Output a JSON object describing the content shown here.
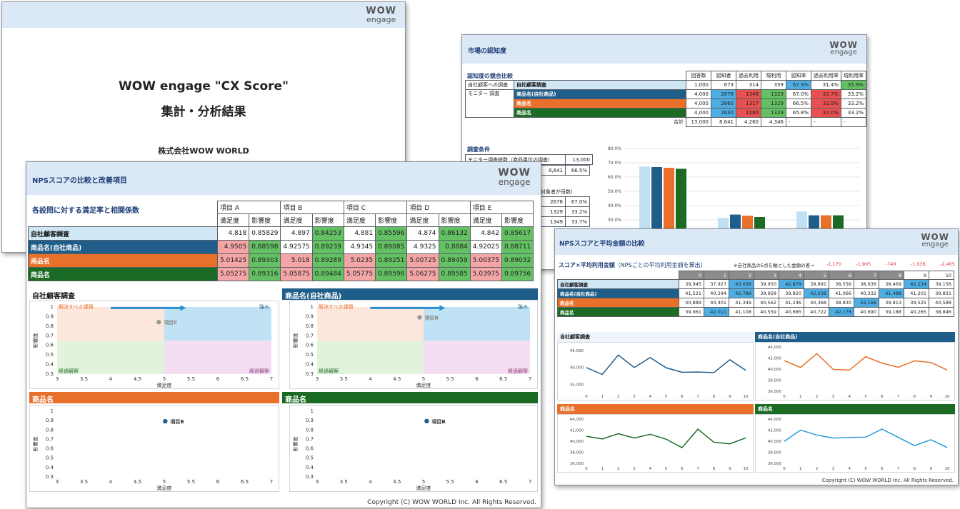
{
  "title_slide": {
    "logo_top": "WOW",
    "logo_bottom": "engage",
    "title_line1": "WOW engage \"CX Score\"",
    "title_line2": "集計・分析結果",
    "company": "株式会社WOW WORLD"
  },
  "recognition_slide": {
    "header": "市場の認知度",
    "logo_top": "WOW",
    "logo_bottom": "engage",
    "section1": "認知度の競合比較",
    "columns": [
      "回答数",
      "認知者",
      "過去利用",
      "現利用",
      "認知率",
      "過去利用率",
      "現利用率"
    ],
    "own_survey_label": "自社顧客への調査",
    "monitor_label": "モニター 調査",
    "rows": [
      {
        "name": "自社顧客調査",
        "values": [
          "1,000",
          "673",
          "314",
          "359",
          "67.3%",
          "31.4%",
          "35.9%"
        ]
      },
      {
        "name": "商品名(自社商品)",
        "values": [
          "4,000",
          "2678",
          "1349",
          "1329",
          "67.0%",
          "33.7%",
          "33.2%"
        ]
      },
      {
        "name": "商品名",
        "values": [
          "4,000",
          "2660",
          "1317",
          "1329",
          "66.5%",
          "32.9%",
          "33.2%"
        ]
      },
      {
        "name": "商品名",
        "values": [
          "4,000",
          "2630",
          "1280",
          "1329",
          "65.8%",
          "32.0%",
          "33.2%"
        ]
      }
    ],
    "total_label": "合計",
    "total_values": [
      "13,000",
      "8,641",
      "4,260",
      "4,346",
      "-",
      "-",
      "-"
    ],
    "section2": "調査条件",
    "cond_label": "モニター調査総数（商品単位の調査）",
    "cond_value": "13,000",
    "cond_row2": [
      "8,641",
      "66.5%"
    ],
    "sub_note": "対象者が母数)",
    "side_rows": [
      [
        "2678",
        "67.0%"
      ],
      [
        "1329",
        "33.2%"
      ],
      [
        "1349",
        "33.7%"
      ]
    ],
    "y_ticks": [
      "80.0%",
      "70.0%",
      "60.0%",
      "50.0%",
      "40.0%",
      "30.0%",
      "20.0%",
      "10.0%"
    ]
  },
  "nps_slide": {
    "header": "NPSスコアの比較と改善項目",
    "logo_top": "WOW",
    "logo_bottom": "engage",
    "subtitle": "各設問に対する満足率と相関係数",
    "items": [
      "項目 A",
      "項目 B",
      "項目 C",
      "項目 D",
      "項目 E"
    ],
    "sub_cols": [
      "満足度",
      "影響度"
    ],
    "rows": [
      {
        "name": "自社顧客調査",
        "values": [
          "4.818",
          "0.85829",
          "4.897",
          "0.84253",
          "4.881",
          "0.85596",
          "4.874",
          "0.86132",
          "4.842",
          "0.85617"
        ]
      },
      {
        "name": "商品名(自社商品)",
        "values": [
          "4.9505",
          "0.88598",
          "4.92575",
          "0.89239",
          "4.9345",
          "0.89085",
          "4.9325",
          "0.8884",
          "4.92025",
          "0.88711"
        ]
      },
      {
        "name": "商品名",
        "values": [
          "5.01425",
          "0.89303",
          "5.018",
          "0.89289",
          "5.0235",
          "0.89251",
          "5.00725",
          "0.89459",
          "5.00375",
          "0.89032"
        ]
      },
      {
        "name": "商品名",
        "values": [
          "5.05275",
          "0.89316",
          "5.05875",
          "0.89484",
          "5.05775",
          "0.89596",
          "5.06275",
          "0.89585",
          "5.03975",
          "0.89756"
        ]
      }
    ],
    "panels": [
      {
        "title": "自社顧客調査",
        "point": "項目C"
      },
      {
        "title": "商品名(自社商品)",
        "point": "項目B"
      },
      {
        "title": "商品名",
        "point": "項目B"
      },
      {
        "title": "商品名",
        "point": "項目B"
      }
    ],
    "quad_issue": "解決すべき課題",
    "quad_strength": "強み",
    "quad_watch": "経過観察",
    "x_label": "満足度",
    "y_label": "影響度",
    "x_ticks": [
      "3",
      "3.5",
      "4",
      "4.5",
      "5",
      "5.5",
      "6",
      "6.5",
      "7"
    ],
    "y_ticks": [
      "1",
      "0.9",
      "0.8",
      "0.7",
      "0.6",
      "0.5",
      "0.4",
      "0.3"
    ],
    "copyright": "Copyright (C) WOW WORLD Inc. All Rights Reserved."
  },
  "amount_slide": {
    "header": "NPSスコアと平均金額の比較",
    "logo_top": "WOW",
    "logo_bottom": "engage",
    "subtitle": "スコア×平均利用金額",
    "subtitle_note": "（NPSごとの平均利用金額を算出）",
    "diff_note": "※自社商品の5点を軸とした金額の差→",
    "diffs": [
      "-1,170",
      "-1,905",
      "-749",
      "-1,036",
      "-2,405"
    ],
    "scores": [
      "0",
      "1",
      "2",
      "3",
      "4",
      "5",
      "6",
      "7",
      "8",
      "9",
      "10"
    ],
    "rows": [
      {
        "name": "自社顧客調査",
        "values": [
          "39,945",
          "37,927",
          "43,636",
          "39,950",
          "42,879",
          "39,891",
          "38,556",
          "38,636",
          "38,469",
          "42,234",
          "39,156"
        ]
      },
      {
        "name": "商品名(自社商品)",
        "values": [
          "41,521",
          "40,294",
          "42,789",
          "39,958",
          "39,820",
          "42,236",
          "41,066",
          "40,332",
          "41,488",
          "41,201",
          "39,831"
        ]
      },
      {
        "name": "商品名",
        "values": [
          "40,889",
          "40,401",
          "41,349",
          "40,562",
          "41,246",
          "40,368",
          "38,830",
          "42,166",
          "39,813",
          "39,525",
          "40,588"
        ]
      },
      {
        "name": "商品名",
        "values": [
          "39,961",
          "42,011",
          "41,108",
          "40,559",
          "40,685",
          "40,722",
          "42,176",
          "40,690",
          "39,188",
          "40,265",
          "38,846"
        ]
      }
    ],
    "charts": [
      {
        "title": "自社顧客調査",
        "yticks": [
          "45,000",
          "40,000",
          "35,000"
        ]
      },
      {
        "title": "商品名(自社商品)",
        "yticks": [
          "44,000",
          "42,000",
          "40,000",
          "38,000",
          "36,000"
        ]
      },
      {
        "title": "商品名",
        "yticks": [
          "44,000",
          "42,000",
          "40,000",
          "38,000",
          "36,000"
        ]
      },
      {
        "title": "商品名",
        "yticks": [
          "44,000",
          "42,000",
          "40,000",
          "38,000",
          "36,000"
        ]
      }
    ],
    "copyright": "Copyright (C) WOW WORLD Inc. All Rights Reserved."
  },
  "colors": {
    "own": "#cfe6f5",
    "brand1": "#1f5d8a",
    "brand2": "#e8702a",
    "brand3": "#1c6b25",
    "header": "#dbe8f6"
  },
  "chart_data": [
    {
      "type": "bar",
      "categories": [
        "認知率",
        "過去利用率",
        "現利用率"
      ],
      "series": [
        {
          "name": "自社顧客調査",
          "values": [
            67.3,
            31.4,
            35.9
          ]
        },
        {
          "name": "商品名(自社商品)",
          "values": [
            67.0,
            33.7,
            33.2
          ]
        },
        {
          "name": "商品名",
          "values": [
            66.5,
            32.9,
            33.2
          ]
        },
        {
          "name": "商品名",
          "values": [
            65.8,
            32.0,
            33.2
          ]
        }
      ],
      "ylim": [
        0,
        80
      ]
    },
    {
      "type": "line",
      "x": [
        0,
        1,
        2,
        3,
        4,
        5,
        6,
        7,
        8,
        9,
        10
      ],
      "series": [
        {
          "name": "自社顧客調査",
          "values": [
            39945,
            37927,
            43636,
            39950,
            42879,
            39891,
            38556,
            38636,
            38469,
            42234,
            39156
          ],
          "ylim": [
            33000,
            46000
          ]
        },
        {
          "name": "商品名(自社商品)",
          "values": [
            41521,
            40294,
            42789,
            39958,
            39820,
            42236,
            41066,
            40332,
            41488,
            41201,
            39831
          ],
          "ylim": [
            36000,
            44000
          ]
        },
        {
          "name": "商品名",
          "values": [
            40889,
            40401,
            41349,
            40562,
            41246,
            40368,
            38830,
            42166,
            39813,
            39525,
            40588
          ],
          "ylim": [
            36000,
            44000
          ]
        },
        {
          "name": "商品名",
          "values": [
            39961,
            42011,
            41108,
            40559,
            40685,
            40722,
            42176,
            40690,
            39188,
            40265,
            38846
          ],
          "ylim": [
            36000,
            44000
          ]
        }
      ]
    }
  ]
}
